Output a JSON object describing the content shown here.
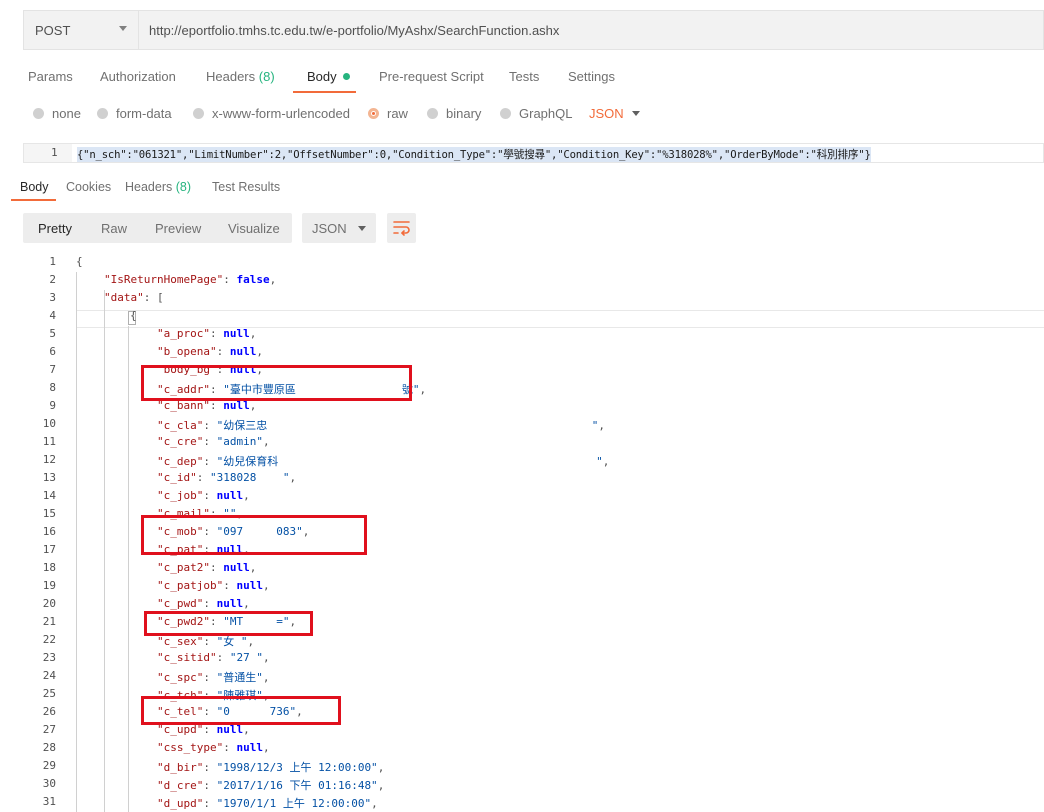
{
  "request": {
    "method": "POST",
    "url": "http://eportfolio.tmhs.tc.edu.tw/e-portfolio/MyAshx/SearchFunction.ashx"
  },
  "request_tabs": {
    "params": "Params",
    "authorization": "Authorization",
    "headers": "Headers",
    "headers_count": "(8)",
    "body": "Body",
    "prerequest": "Pre-request Script",
    "tests": "Tests",
    "settings": "Settings"
  },
  "body_types": {
    "none": "none",
    "form_data": "form-data",
    "urlencoded": "x-www-form-urlencoded",
    "raw": "raw",
    "binary": "binary",
    "graphql": "GraphQL",
    "format": "JSON"
  },
  "raw_body": {
    "line_number": "1",
    "text": "{\"n_sch\":\"061321\",\"LimitNumber\":2,\"OffsetNumber\":0,\"Condition_Type\":\"學號搜尋\",\"Condition_Key\":\"%318028%\",\"OrderByMode\":\"科別排序\"}"
  },
  "response_tabs": {
    "body": "Body",
    "cookies": "Cookies",
    "headers": "Headers",
    "headers_count": "(8)",
    "test_results": "Test Results"
  },
  "view_modes": {
    "pretty": "Pretty",
    "raw": "Raw",
    "preview": "Preview",
    "visualize": "Visualize",
    "format": "JSON"
  },
  "icons": {
    "dropdown": "chevron-down-icon",
    "wrap": "wrap-lines-icon"
  },
  "colors": {
    "accent": "#f26b3a",
    "green": "#26b47f",
    "highlight_box": "#e0101d"
  },
  "code_lines": [
    {
      "n": "1",
      "text": "{"
    },
    {
      "n": "2",
      "key": "\"IsReturnHomePage\"",
      "sep": ": ",
      "val": "false",
      "end": ","
    },
    {
      "n": "3",
      "key": "\"data\"",
      "sep": ": ",
      "text": "["
    },
    {
      "n": "4",
      "text": "{"
    },
    {
      "n": "5",
      "key": "\"a_proc\"",
      "sep": ": ",
      "val": "null",
      "end": ","
    },
    {
      "n": "6",
      "key": "\"b_opena\"",
      "sep": ": ",
      "val": "null",
      "end": ","
    },
    {
      "n": "7",
      "key": "\"body_bg\"",
      "sep": ": ",
      "val": "null",
      "end": ","
    },
    {
      "n": "8",
      "key": "\"c_addr\"",
      "sep": ": ",
      "str": "\"臺中市豐原區                號\"",
      "end": ","
    },
    {
      "n": "9",
      "key": "\"c_bann\"",
      "sep": ": ",
      "val": "null",
      "end": ","
    },
    {
      "n": "10",
      "key": "\"c_cla\"",
      "sep": ": ",
      "str": "\"幼保三忠                                                 \"",
      "end": ","
    },
    {
      "n": "11",
      "key": "\"c_cre\"",
      "sep": ": ",
      "str": "\"admin\"",
      "end": ","
    },
    {
      "n": "12",
      "key": "\"c_dep\"",
      "sep": ": ",
      "str": "\"幼兒保育科                                                \"",
      "end": ","
    },
    {
      "n": "13",
      "key": "\"c_id\"",
      "sep": ": ",
      "str": "\"318028    \"",
      "end": ","
    },
    {
      "n": "14",
      "key": "\"c_job\"",
      "sep": ": ",
      "val": "null",
      "end": ","
    },
    {
      "n": "15",
      "key": "\"c_mail\"",
      "sep": ": ",
      "str": "\"\"",
      "end": ","
    },
    {
      "n": "16",
      "key": "\"c_mob\"",
      "sep": ": ",
      "str": "\"097     083\"",
      "end": ","
    },
    {
      "n": "17",
      "key": "\"c_pat\"",
      "sep": ": ",
      "val": "null",
      "end": ","
    },
    {
      "n": "18",
      "key": "\"c_pat2\"",
      "sep": ": ",
      "val": "null",
      "end": ","
    },
    {
      "n": "19",
      "key": "\"c_patjob\"",
      "sep": ": ",
      "val": "null",
      "end": ","
    },
    {
      "n": "20",
      "key": "\"c_pwd\"",
      "sep": ": ",
      "val": "null",
      "end": ","
    },
    {
      "n": "21",
      "key": "\"c_pwd2\"",
      "sep": ": ",
      "str": "\"MT     =\"",
      "end": ","
    },
    {
      "n": "22",
      "key": "\"c_sex\"",
      "sep": ": ",
      "str": "\"女 \"",
      "end": ","
    },
    {
      "n": "23",
      "key": "\"c_sitid\"",
      "sep": ": ",
      "str": "\"27 \"",
      "end": ","
    },
    {
      "n": "24",
      "key": "\"c_spc\"",
      "sep": ": ",
      "str": "\"普通生\"",
      "end": ","
    },
    {
      "n": "25",
      "key": "\"c_tch\"",
      "sep": ": ",
      "str": "\"陳雅琪\"",
      "end": ","
    },
    {
      "n": "26",
      "key": "\"c_tel\"",
      "sep": ": ",
      "str": "\"0      736\"",
      "end": ","
    },
    {
      "n": "27",
      "key": "\"c_upd\"",
      "sep": ": ",
      "val": "null",
      "end": ","
    },
    {
      "n": "28",
      "key": "\"css_type\"",
      "sep": ": ",
      "val": "null",
      "end": ","
    },
    {
      "n": "29",
      "key": "\"d_bir\"",
      "sep": ": ",
      "str": "\"1998/12/3 上午 12:00:00\"",
      "end": ","
    },
    {
      "n": "30",
      "key": "\"d_cre\"",
      "sep": ": ",
      "str": "\"2017/1/16 下午 01:16:48\"",
      "end": ","
    },
    {
      "n": "31",
      "key": "\"d_upd\"",
      "sep": ": ",
      "str": "\"1970/1/1 上午 12:00:00\"",
      "end": ","
    }
  ]
}
